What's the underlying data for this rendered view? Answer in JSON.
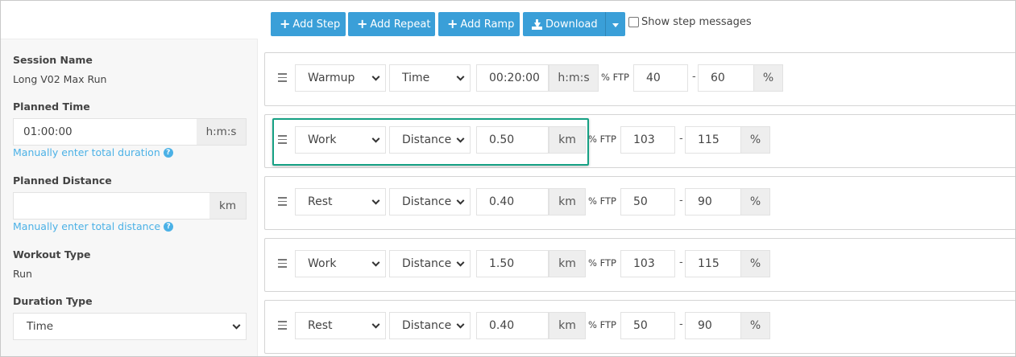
{
  "toolbar": {
    "add_step": "Add Step",
    "add_repeat": "Add Repeat",
    "add_ramp": "Add Ramp",
    "download": "Download",
    "show_step_messages": "Show step messages",
    "accent_color": "#3a9fd8"
  },
  "sidebar": {
    "session_name_label": "Session Name",
    "session_name_value": "Long V02 Max Run",
    "planned_time_label": "Planned Time",
    "planned_time_value": "01:00:00",
    "planned_time_unit": "h:m:s",
    "manual_duration_link": "Manually enter total duration",
    "planned_distance_label": "Planned Distance",
    "planned_distance_value": "",
    "planned_distance_unit": "km",
    "manual_distance_link": "Manually enter total distance",
    "workout_type_label": "Workout Type",
    "workout_type_value": "Run",
    "duration_type_label": "Duration Type",
    "duration_type_value": "Time",
    "link_color": "#4bb1e6"
  },
  "steps": [
    {
      "type": "Warmup",
      "measure": "Time",
      "amount": "00:20:00",
      "unit": "h:m:s",
      "ftp_label": "% FTP",
      "low": "40",
      "dash": "-",
      "high": "60",
      "pct": "%"
    },
    {
      "type": "Work",
      "measure": "Distance",
      "amount": "0.50",
      "unit": "km",
      "ftp_label": "% FTP",
      "low": "103",
      "dash": "-",
      "high": "115",
      "pct": "%",
      "highlighted": true
    },
    {
      "type": "Rest",
      "measure": "Distance",
      "amount": "0.40",
      "unit": "km",
      "ftp_label": "% FTP",
      "low": "50",
      "dash": "-",
      "high": "90",
      "pct": "%"
    },
    {
      "type": "Work",
      "measure": "Distance",
      "amount": "1.50",
      "unit": "km",
      "ftp_label": "% FTP",
      "low": "103",
      "dash": "-",
      "high": "115",
      "pct": "%"
    },
    {
      "type": "Rest",
      "measure": "Distance",
      "amount": "0.40",
      "unit": "km",
      "ftp_label": "% FTP",
      "low": "50",
      "dash": "-",
      "high": "90",
      "pct": "%"
    }
  ],
  "highlight_color": "#16a184"
}
